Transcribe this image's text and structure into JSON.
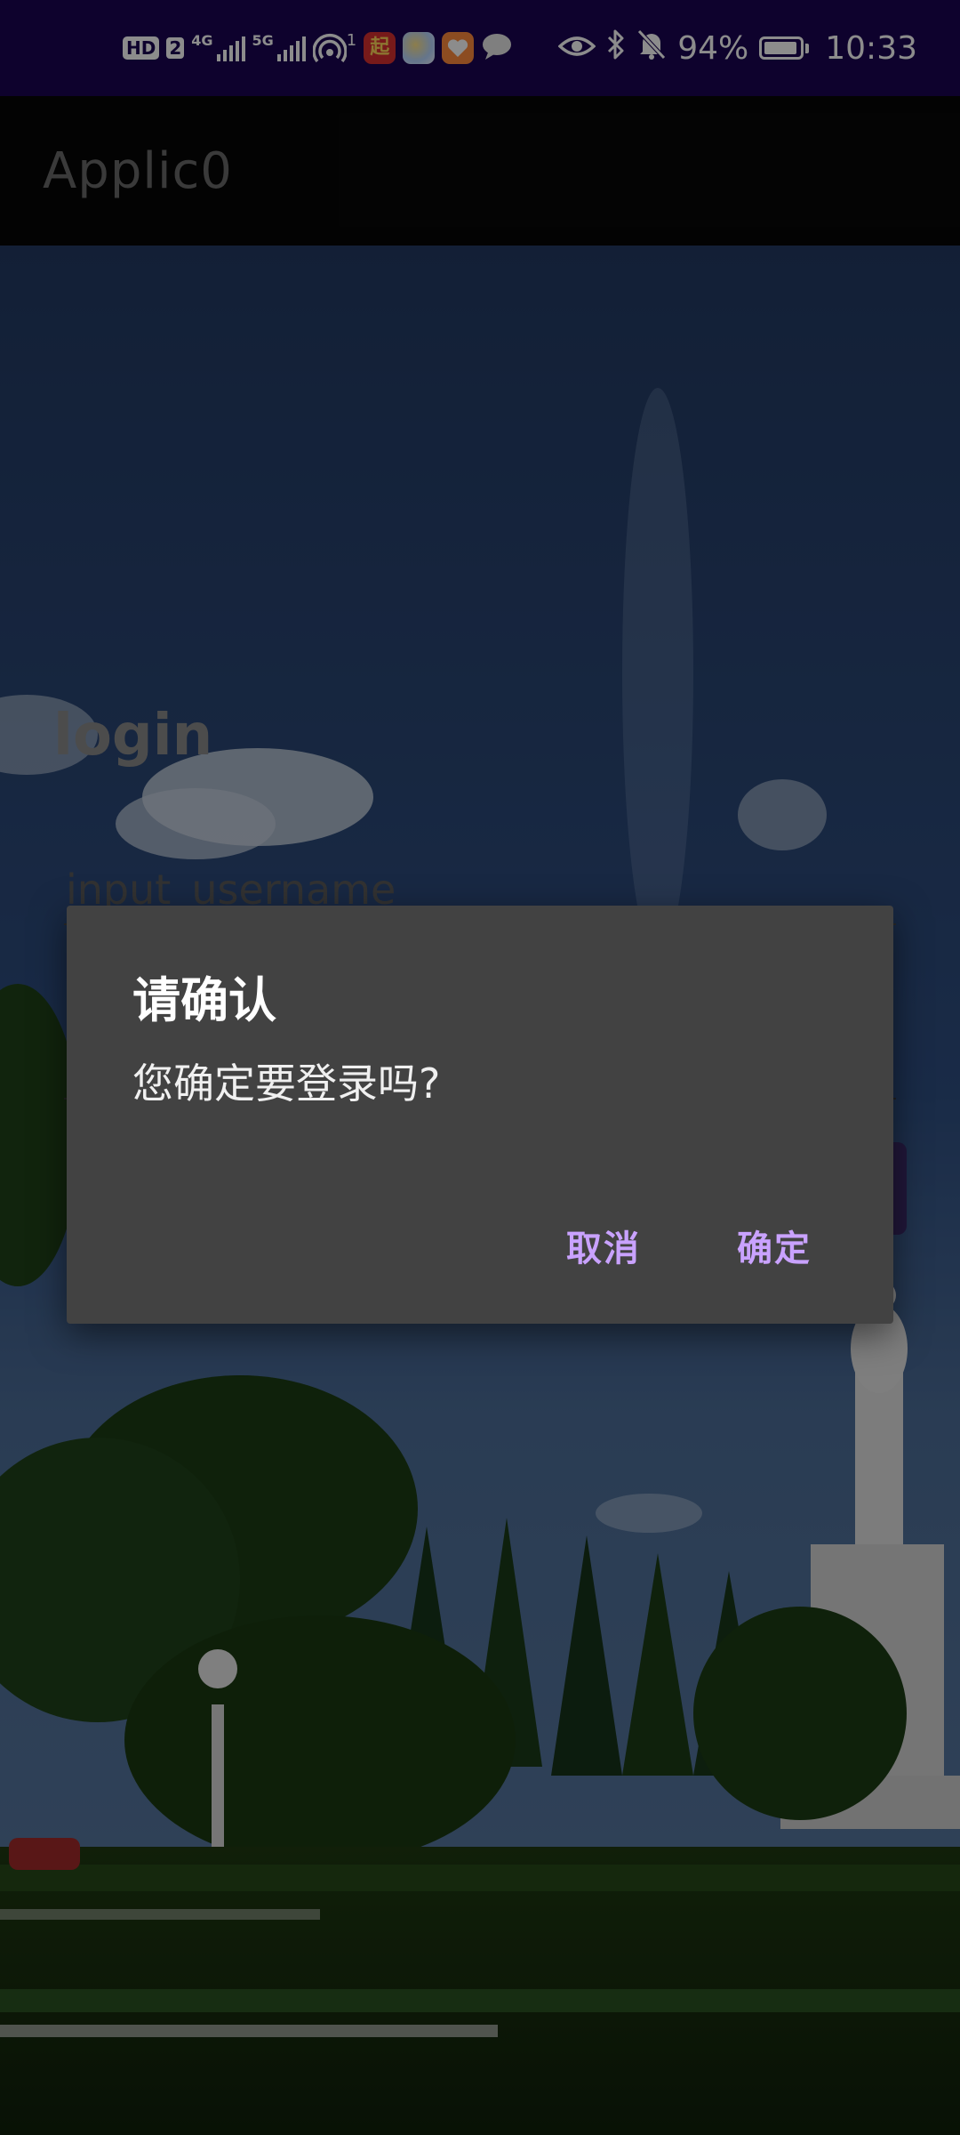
{
  "status_bar": {
    "hd_label": "HD",
    "sim_number": "2",
    "network1": "4G",
    "network2": "5G",
    "hotspot_count": "1",
    "battery_percent": "94%",
    "battery_level": 0.94,
    "time": "10:33",
    "icons": [
      "hotspot-icon",
      "qidian-app-icon",
      "gallery-app-icon",
      "health-app-icon",
      "message-icon",
      "eye-comfort-icon",
      "bluetooth-icon",
      "mute-bell-icon",
      "battery-icon"
    ]
  },
  "app_bar": {
    "title": "Applic0"
  },
  "login": {
    "title": "login",
    "username_placeholder": "input_username"
  },
  "dialog": {
    "title": "请确认",
    "message": "您确定要登录吗?",
    "cancel_label": "取消",
    "confirm_label": "确定"
  },
  "colors": {
    "status_bar_bg": "#1a0552",
    "app_bar_bg": "#070707",
    "dialog_bg": "#424242",
    "accent": "#c9a2ff"
  }
}
